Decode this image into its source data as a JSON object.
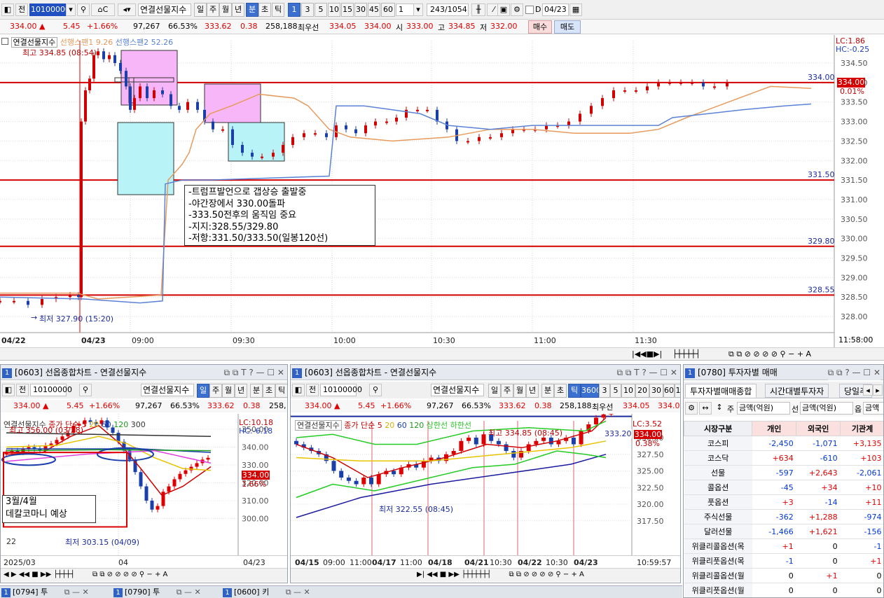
{
  "toolbar": {
    "code": "10100000",
    "btn_jeon": "전",
    "market": "연결선물지수",
    "periods": [
      "일",
      "주",
      "월",
      "년",
      "분",
      "초",
      "틱"
    ],
    "active_period": "분",
    "intervals": [
      "1",
      "3",
      "5",
      "10",
      "15",
      "30",
      "45",
      "60"
    ],
    "active_interval": "1",
    "count": "1",
    "range": "243/1054",
    "check_label": "D",
    "date": "04/23"
  },
  "quote": {
    "price": "334.00",
    "arrow": "▲",
    "change": "5.45",
    "pct": "+1.66%",
    "volume": "97,267",
    "ratio": "66.53%",
    "prev": "333.62",
    "diff": "0.38",
    "oi": "258,188",
    "best_label": "최우선",
    "best_ask": "334.05",
    "best_bid": "334.00",
    "open_label": "시",
    "open": "333.00",
    "high_label": "고",
    "high": "334.85",
    "low_label": "저",
    "low": "332.00",
    "buy": "매수",
    "sell": "매도"
  },
  "main_chart": {
    "legend_name": "연결선물지수",
    "legend_span1": "선행스팬1 9.26",
    "legend_span2": "선행스팬2 52.26",
    "lc": "LC:1.86",
    "hc": "HC:-0.25",
    "high_label": "최고 334.85 (08:54)",
    "low_label": "최저 327.90 (15:20)",
    "price_tag": "334.00",
    "pct_tag": "0.01%",
    "clock": "11:58:00",
    "y_labels": [
      "334.50",
      "334.00",
      "333.50",
      "333.00",
      "332.50",
      "332.00",
      "331.50",
      "331.00",
      "330.50",
      "330.00",
      "329.50",
      "329.00",
      "328.50",
      "328.00"
    ],
    "x_labels": [
      "04/22",
      "04/23",
      "09:00",
      "09:30",
      "10:00",
      "10:30",
      "11:00",
      "11:30"
    ],
    "hline_labels": [
      "334.00",
      "331.50",
      "329.80",
      "328.55"
    ],
    "notes": [
      "-트럼프발언으로 갭상승 출발중",
      "-야간장에서 330.00돌파",
      "-333.50전후의 움직임 중요",
      "-지지:328.55/329.80",
      "-저항:331.50/333.50(일봉120선)"
    ]
  },
  "panel1": {
    "title": "[0603] 선옵종합차트 - 연결선물지수",
    "code": "10100000",
    "btn_jeon": "전",
    "market": "연결선물지수",
    "periods": [
      "일",
      "주",
      "월",
      "년",
      "분",
      "초",
      "틱"
    ],
    "price": "334.00",
    "arrow": "▲",
    "change": "5.45",
    "pct": "+1.66%",
    "volume": "97,267",
    "ratio": "66.53%",
    "prev": "333.62",
    "diff": "0.38",
    "oi": "258,",
    "legend_name": "연결선물지수",
    "legend_ma": "종가 단순",
    "ma_vals": [
      "5",
      "20",
      "60",
      "120",
      "300"
    ],
    "lc": "LC:10.18",
    "hc": "HC:-6.18",
    "high_label": "최고 356.00 (03/28)",
    "low_label": "최저 303.15 (04/09)",
    "y_labels": [
      "350.00",
      "340.00",
      "330.00",
      "320.00",
      "310.00",
      "300.00"
    ],
    "price_tag": "334.00",
    "pct_tag": "1.66%",
    "note1": "3월/4월",
    "note2": "데칼코마니 예상",
    "x_labels": [
      "2025/03",
      "04",
      "04/23"
    ],
    "label22": "22"
  },
  "panel2": {
    "title": "[0603] 선옵종합차트 - 연결선물지수",
    "code": "10100000",
    "btn_jeon": "전",
    "market": "연결선물지수",
    "periods": [
      "일",
      "주",
      "월",
      "년",
      "분",
      "초",
      "틱"
    ],
    "intervals": [
      "3600",
      "3",
      "5",
      "10",
      "20",
      "30",
      "60",
      "1"
    ],
    "price": "334.00",
    "arrow": "▲",
    "change": "5.45",
    "pct": "+1.66%",
    "volume": "97,267",
    "ratio": "66.53%",
    "prev": "333.62",
    "diff": "0.38",
    "oi": "258,188",
    "best_label": "최우선",
    "best_ask": "334.05",
    "best_bid": "334.0",
    "legend_name": "연결선물지수",
    "legend_ma": "종가 단순",
    "ma_vals": [
      "5",
      "20",
      "60",
      "120"
    ],
    "legend_band": "상한선 하한선",
    "lc": "LC:3.52",
    "pct_tag": "0.38%",
    "high_label": "최고 334.85 (08:45)",
    "low_label": "최저 322.55 (08:45)",
    "price_box": "333.20",
    "price_tag": "334.00",
    "y_labels": [
      "330.00",
      "327.50",
      "325.00",
      "322.50",
      "320.00",
      "317.50"
    ],
    "x_labels": [
      "04/15",
      "09:00",
      "11:00",
      "04/17",
      "11:00",
      "04/18",
      "04/21",
      "10:30",
      "04/22",
      "10:30",
      "04/23"
    ],
    "clock": "10:59:57"
  },
  "panel3": {
    "title": "[0780] 투자자별 매매",
    "tabs": [
      "투자자별매매종합",
      "시간대별투자자",
      "당일추"
    ],
    "unit1": "주",
    "unit_sel1": "금액(억원)",
    "unit2": "선",
    "unit_sel2": "금액(억원)",
    "unit3": "옵",
    "unit_sel3": "금액",
    "headers": [
      "시장구분",
      "개인",
      "외국인",
      "기관계"
    ],
    "rows": [
      [
        "코스피",
        "-2,450",
        "-1,071",
        "+3,135"
      ],
      [
        "코스닥",
        "+634",
        "-610",
        "+103"
      ],
      [
        "선물",
        "-597",
        "+2,643",
        "-2,061"
      ],
      [
        "콜옵션",
        "-45",
        "+34",
        "+10"
      ],
      [
        "풋옵션",
        "+3",
        "-14",
        "+11"
      ],
      [
        "주식선물",
        "-362",
        "+1,288",
        "-974"
      ],
      [
        "달러선물",
        "-1,466",
        "+1,621",
        "-156"
      ],
      [
        "위클리콜옵션(목",
        "+1",
        "0",
        "-1"
      ],
      [
        "위클리풋옵션(목",
        "-1",
        "0",
        "+1"
      ],
      [
        "위클리콜옵션(월",
        "0",
        "+1",
        "0"
      ],
      [
        "위클리풋옵션(월",
        "0",
        "0",
        "0"
      ]
    ]
  },
  "taskbar": [
    "[0794] 투",
    "[0790] 투",
    "[0600] 키"
  ]
}
